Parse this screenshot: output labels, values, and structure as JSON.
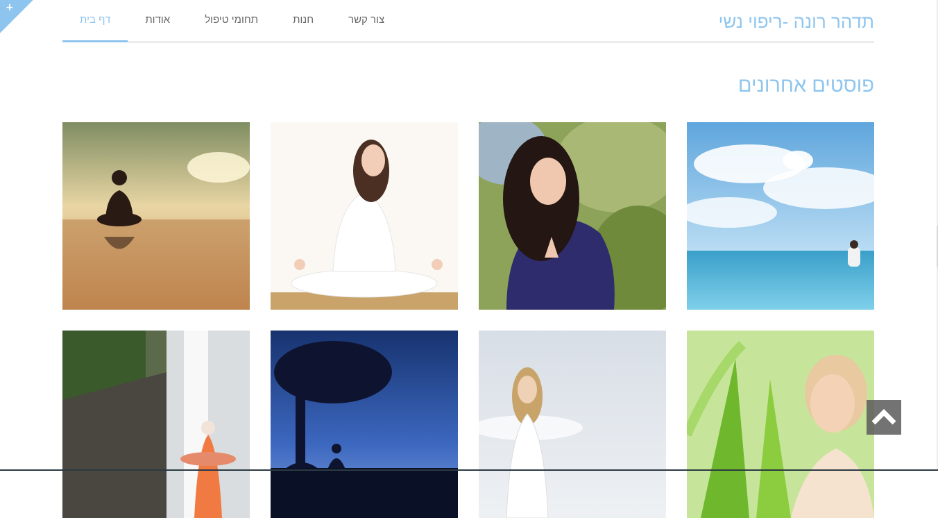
{
  "site": {
    "title": "תדהר רונה -ריפוי נשי"
  },
  "nav": {
    "items": [
      {
        "label": "דף בית",
        "active": true
      },
      {
        "label": "אודות",
        "active": false
      },
      {
        "label": "תחומי טיפול",
        "active": false
      },
      {
        "label": "חנות",
        "active": false
      },
      {
        "label": "צור קשר",
        "active": false
      }
    ]
  },
  "posts": {
    "heading": "פוסטים אחרונים"
  },
  "icons": {
    "corner": "plus-icon",
    "scroll_top": "chevron-up-icon"
  },
  "colors": {
    "accent": "#8ec5ee",
    "nav_text": "#666666",
    "scroll_button": "#5a5a5a"
  }
}
